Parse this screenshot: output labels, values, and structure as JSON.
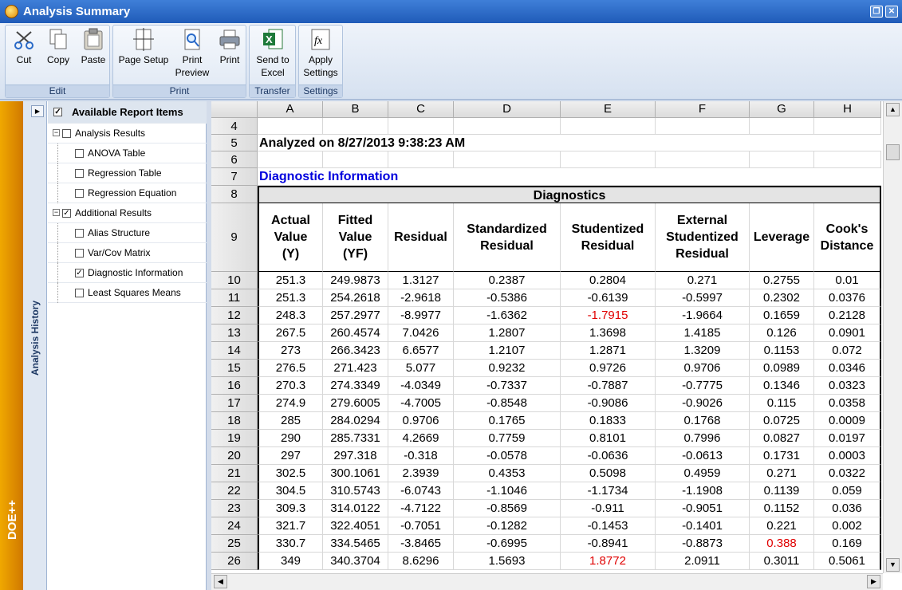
{
  "window": {
    "title": "Analysis Summary"
  },
  "ribbon": {
    "groups": [
      {
        "label": "Edit",
        "buttons": [
          "Cut",
          "Copy",
          "Paste"
        ]
      },
      {
        "label": "Print",
        "buttons": [
          "Page Setup",
          "Print Preview",
          "Print"
        ]
      },
      {
        "label": "Transfer",
        "buttons": [
          "Send to Excel"
        ]
      },
      {
        "label": "Settings",
        "buttons": [
          "Apply Settings"
        ]
      }
    ]
  },
  "sidebar": {
    "history_label": "Analysis History",
    "brand": "DOE++"
  },
  "tree": {
    "root": "Available Report Items",
    "items": [
      {
        "label": "Analysis Results",
        "level": 0,
        "checked": false
      },
      {
        "label": "ANOVA Table",
        "level": 1,
        "checked": false
      },
      {
        "label": "Regression Table",
        "level": 1,
        "checked": false
      },
      {
        "label": "Regression Equation",
        "level": 1,
        "checked": false
      },
      {
        "label": "Additional Results",
        "level": 0,
        "checked": true
      },
      {
        "label": "Alias Structure",
        "level": 1,
        "checked": false
      },
      {
        "label": "Var/Cov Matrix",
        "level": 1,
        "checked": false
      },
      {
        "label": "Diagnostic Information",
        "level": 1,
        "checked": true
      },
      {
        "label": "Least Squares Means",
        "level": 1,
        "checked": false
      }
    ]
  },
  "sheet": {
    "columns": [
      "A",
      "B",
      "C",
      "D",
      "E",
      "F",
      "G",
      "H"
    ],
    "analyzed_text": "Analyzed on 8/27/2013 9:38:23 AM",
    "section_title": "Diagnostic Information",
    "table_title": "Diagnostics",
    "headers": [
      "Actual\nValue\n(Y)",
      "Fitted\nValue\n(YF)",
      "Residual",
      "Standardized\nResidual",
      "Studentized\nResidual",
      "External\nStudentized\nResidual",
      "Leverage",
      "Cook's\nDistance"
    ],
    "top_rows": [
      "4",
      "5",
      "6",
      "7",
      "8",
      "9"
    ],
    "rows": [
      {
        "n": "10",
        "v": [
          "251.3",
          "249.9873",
          "1.3127",
          "0.2387",
          "0.2804",
          "0.271",
          "0.2755",
          "0.01"
        ]
      },
      {
        "n": "11",
        "v": [
          "251.3",
          "254.2618",
          "-2.9618",
          "-0.5386",
          "-0.6139",
          "-0.5997",
          "0.2302",
          "0.0376"
        ]
      },
      {
        "n": "12",
        "v": [
          "248.3",
          "257.2977",
          "-8.9977",
          "-1.6362",
          "-1.7915",
          "-1.9664",
          "0.1659",
          "0.2128"
        ],
        "red": [
          4
        ]
      },
      {
        "n": "13",
        "v": [
          "267.5",
          "260.4574",
          "7.0426",
          "1.2807",
          "1.3698",
          "1.4185",
          "0.126",
          "0.0901"
        ]
      },
      {
        "n": "14",
        "v": [
          "273",
          "266.3423",
          "6.6577",
          "1.2107",
          "1.2871",
          "1.3209",
          "0.1153",
          "0.072"
        ]
      },
      {
        "n": "15",
        "v": [
          "276.5",
          "271.423",
          "5.077",
          "0.9232",
          "0.9726",
          "0.9706",
          "0.0989",
          "0.0346"
        ]
      },
      {
        "n": "16",
        "v": [
          "270.3",
          "274.3349",
          "-4.0349",
          "-0.7337",
          "-0.7887",
          "-0.7775",
          "0.1346",
          "0.0323"
        ]
      },
      {
        "n": "17",
        "v": [
          "274.9",
          "279.6005",
          "-4.7005",
          "-0.8548",
          "-0.9086",
          "-0.9026",
          "0.115",
          "0.0358"
        ]
      },
      {
        "n": "18",
        "v": [
          "285",
          "284.0294",
          "0.9706",
          "0.1765",
          "0.1833",
          "0.1768",
          "0.0725",
          "0.0009"
        ]
      },
      {
        "n": "19",
        "v": [
          "290",
          "285.7331",
          "4.2669",
          "0.7759",
          "0.8101",
          "0.7996",
          "0.0827",
          "0.0197"
        ]
      },
      {
        "n": "20",
        "v": [
          "297",
          "297.318",
          "-0.318",
          "-0.0578",
          "-0.0636",
          "-0.0613",
          "0.1731",
          "0.0003"
        ]
      },
      {
        "n": "21",
        "v": [
          "302.5",
          "300.1061",
          "2.3939",
          "0.4353",
          "0.5098",
          "0.4959",
          "0.271",
          "0.0322"
        ]
      },
      {
        "n": "22",
        "v": [
          "304.5",
          "310.5743",
          "-6.0743",
          "-1.1046",
          "-1.1734",
          "-1.1908",
          "0.1139",
          "0.059"
        ]
      },
      {
        "n": "23",
        "v": [
          "309.3",
          "314.0122",
          "-4.7122",
          "-0.8569",
          "-0.911",
          "-0.9051",
          "0.1152",
          "0.036"
        ]
      },
      {
        "n": "24",
        "v": [
          "321.7",
          "322.4051",
          "-0.7051",
          "-0.1282",
          "-0.1453",
          "-0.1401",
          "0.221",
          "0.002"
        ]
      },
      {
        "n": "25",
        "v": [
          "330.7",
          "334.5465",
          "-3.8465",
          "-0.6995",
          "-0.8941",
          "-0.8873",
          "0.388",
          "0.169"
        ],
        "red": [
          6
        ]
      },
      {
        "n": "26",
        "v": [
          "349",
          "340.3704",
          "8.6296",
          "1.5693",
          "1.8772",
          "2.0911",
          "0.3011",
          "0.5061"
        ],
        "red": [
          4
        ]
      }
    ]
  }
}
